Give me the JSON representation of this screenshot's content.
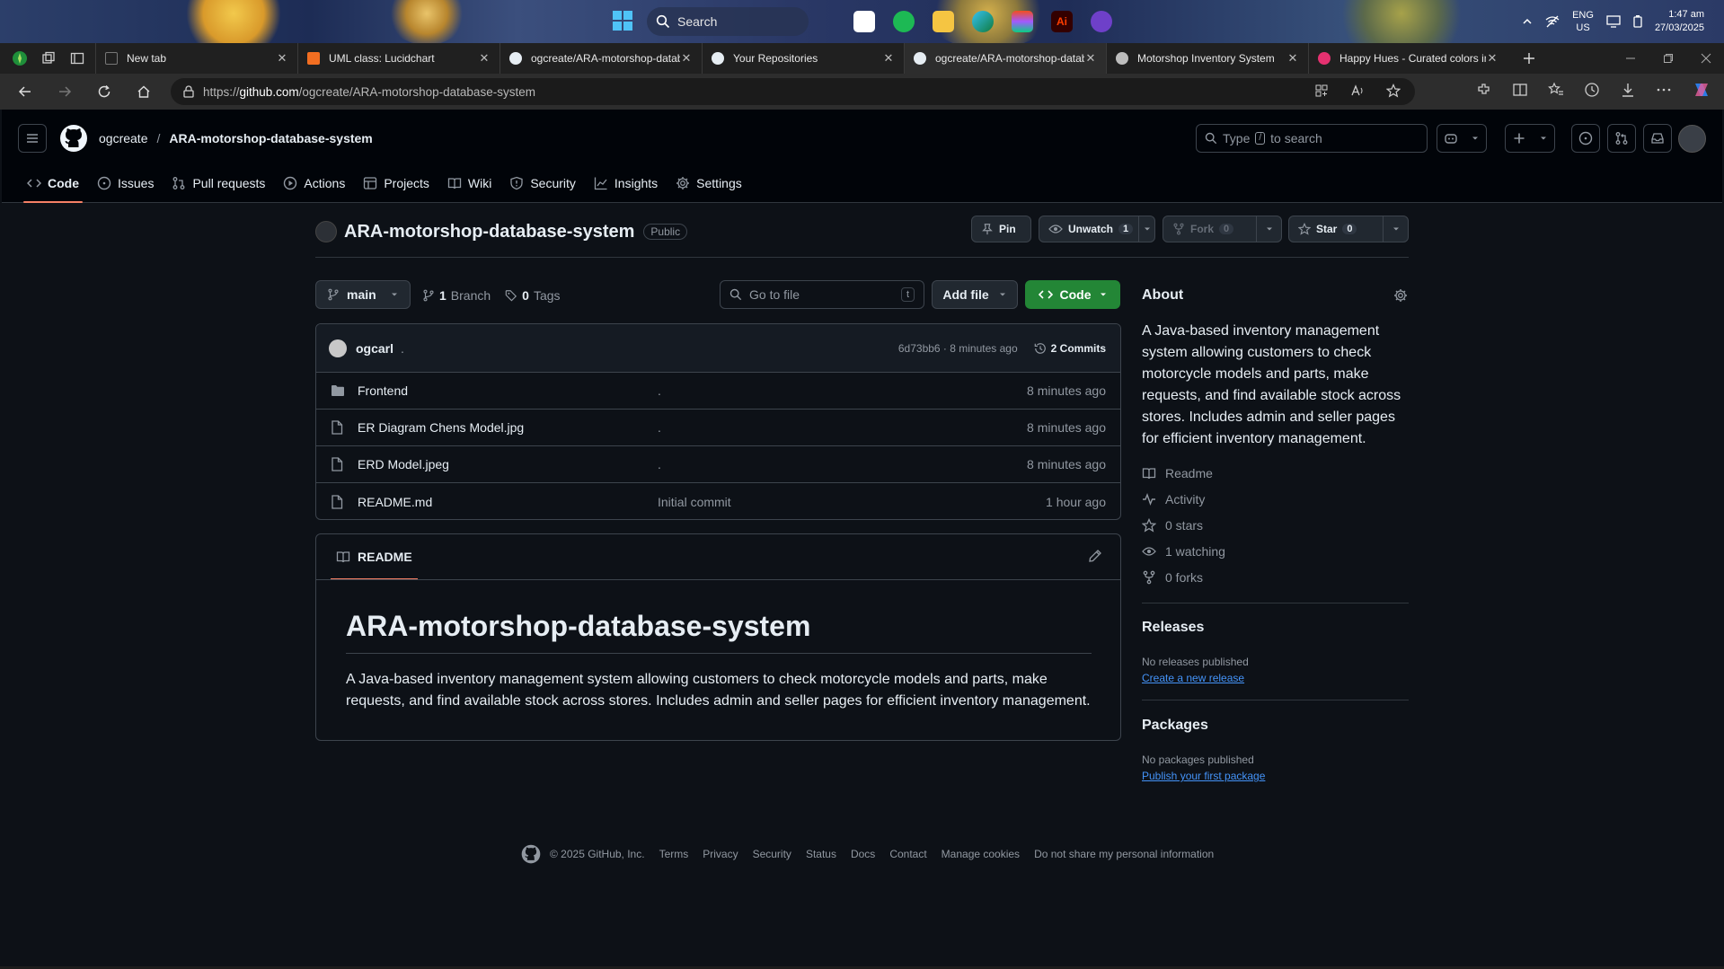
{
  "taskbar": {
    "search_label": "Search",
    "lang_line1": "ENG",
    "lang_line2": "US",
    "time": "1:47 am",
    "date": "27/03/2025"
  },
  "browser": {
    "tabs": [
      {
        "title": "New tab",
        "favicon_color": "#6b6b6b"
      },
      {
        "title": "UML class: Lucidchart",
        "favicon_color": "#f26e21"
      },
      {
        "title": "ogcreate/ARA-motorshop-datab",
        "favicon_color": "#e6edf3"
      },
      {
        "title": "Your Repositories",
        "favicon_color": "#e6edf3"
      },
      {
        "title": "ogcreate/ARA-motorshop-datab",
        "favicon_color": "#e6edf3"
      },
      {
        "title": "Motorshop Inventory System",
        "favicon_color": "#bdbdbd"
      },
      {
        "title": "Happy Hues - Curated colors in",
        "favicon_color": "#e53170"
      }
    ],
    "url_prefix": "https://",
    "url_host": "github.com",
    "url_path": "/ogcreate/ARA-motorshop-database-system"
  },
  "github": {
    "owner": "ogcreate",
    "separator": "/",
    "repo": "ARA-motorshop-database-system",
    "search_placeholder_pre": "Type",
    "search_key": "/",
    "search_placeholder_post": "to search",
    "repo_nav": [
      {
        "label": "Code",
        "icon": "code-icon"
      },
      {
        "label": "Issues",
        "icon": "issue-icon"
      },
      {
        "label": "Pull requests",
        "icon": "pull-request-icon"
      },
      {
        "label": "Actions",
        "icon": "play-icon"
      },
      {
        "label": "Projects",
        "icon": "table-icon"
      },
      {
        "label": "Wiki",
        "icon": "book-icon"
      },
      {
        "label": "Security",
        "icon": "shield-icon"
      },
      {
        "label": "Insights",
        "icon": "graph-icon"
      },
      {
        "label": "Settings",
        "icon": "gear-icon"
      }
    ]
  },
  "repo_head": {
    "name": "ARA-motorshop-database-system",
    "visibility": "Public",
    "pin_label": "Pin",
    "unwatch_label": "Unwatch",
    "unwatch_count": "1",
    "fork_label": "Fork",
    "fork_count": "0",
    "star_label": "Star",
    "star_count": "0"
  },
  "file_controls": {
    "branch": "main",
    "branch_count": "1",
    "branch_word": "Branch",
    "tag_count": "0",
    "tag_word": "Tags",
    "goto_placeholder": "Go to file",
    "goto_key": "t",
    "add_file_label": "Add file",
    "code_label": "Code"
  },
  "latest_commit": {
    "user": "ogcarl",
    "message": ".",
    "hash_time": "6d73bb6 · 8 minutes ago",
    "commits_label": "2 Commits"
  },
  "files": [
    {
      "type": "folder",
      "name": "Frontend",
      "message": ".",
      "time": "8 minutes ago"
    },
    {
      "type": "file",
      "name": "ER Diagram Chens Model.jpg",
      "message": ".",
      "time": "8 minutes ago"
    },
    {
      "type": "file",
      "name": "ERD Model.jpeg",
      "message": ".",
      "time": "8 minutes ago"
    },
    {
      "type": "file",
      "name": "README.md",
      "message": "Initial commit",
      "time": "1 hour ago"
    }
  ],
  "readme": {
    "tab_label": "README",
    "heading": "ARA-motorshop-database-system",
    "body": "A Java-based inventory management system allowing customers to check motorcycle models and parts, make requests, and find available stock across stores. Includes admin and seller pages for efficient inventory management."
  },
  "about": {
    "title": "About",
    "description": "A Java-based inventory management system allowing customers to check motorcycle models and parts, make requests, and find available stock across stores. Includes admin and seller pages for efficient inventory management.",
    "links": [
      {
        "label": "Readme",
        "icon": "book-icon"
      },
      {
        "label": "Activity",
        "icon": "pulse-icon"
      },
      {
        "label": "0 stars",
        "icon": "star-icon"
      },
      {
        "label": "1 watching",
        "icon": "eye-icon"
      },
      {
        "label": "0 forks",
        "icon": "fork-icon"
      }
    ],
    "releases_title": "Releases",
    "releases_note": "No releases published",
    "releases_link": "Create a new release",
    "packages_title": "Packages",
    "packages_note": "No packages published",
    "packages_link": "Publish your first package"
  },
  "footer": {
    "copyright": "© 2025 GitHub, Inc.",
    "links": [
      "Terms",
      "Privacy",
      "Security",
      "Status",
      "Docs",
      "Contact",
      "Manage cookies",
      "Do not share my personal information"
    ]
  },
  "colors": {
    "bg": "#0d1117",
    "header_bg": "#010409",
    "border": "#3d444d",
    "accent_underline": "#f78166",
    "link": "#4493f8",
    "primary_button": "#238636",
    "muted_text": "#9198a1"
  }
}
